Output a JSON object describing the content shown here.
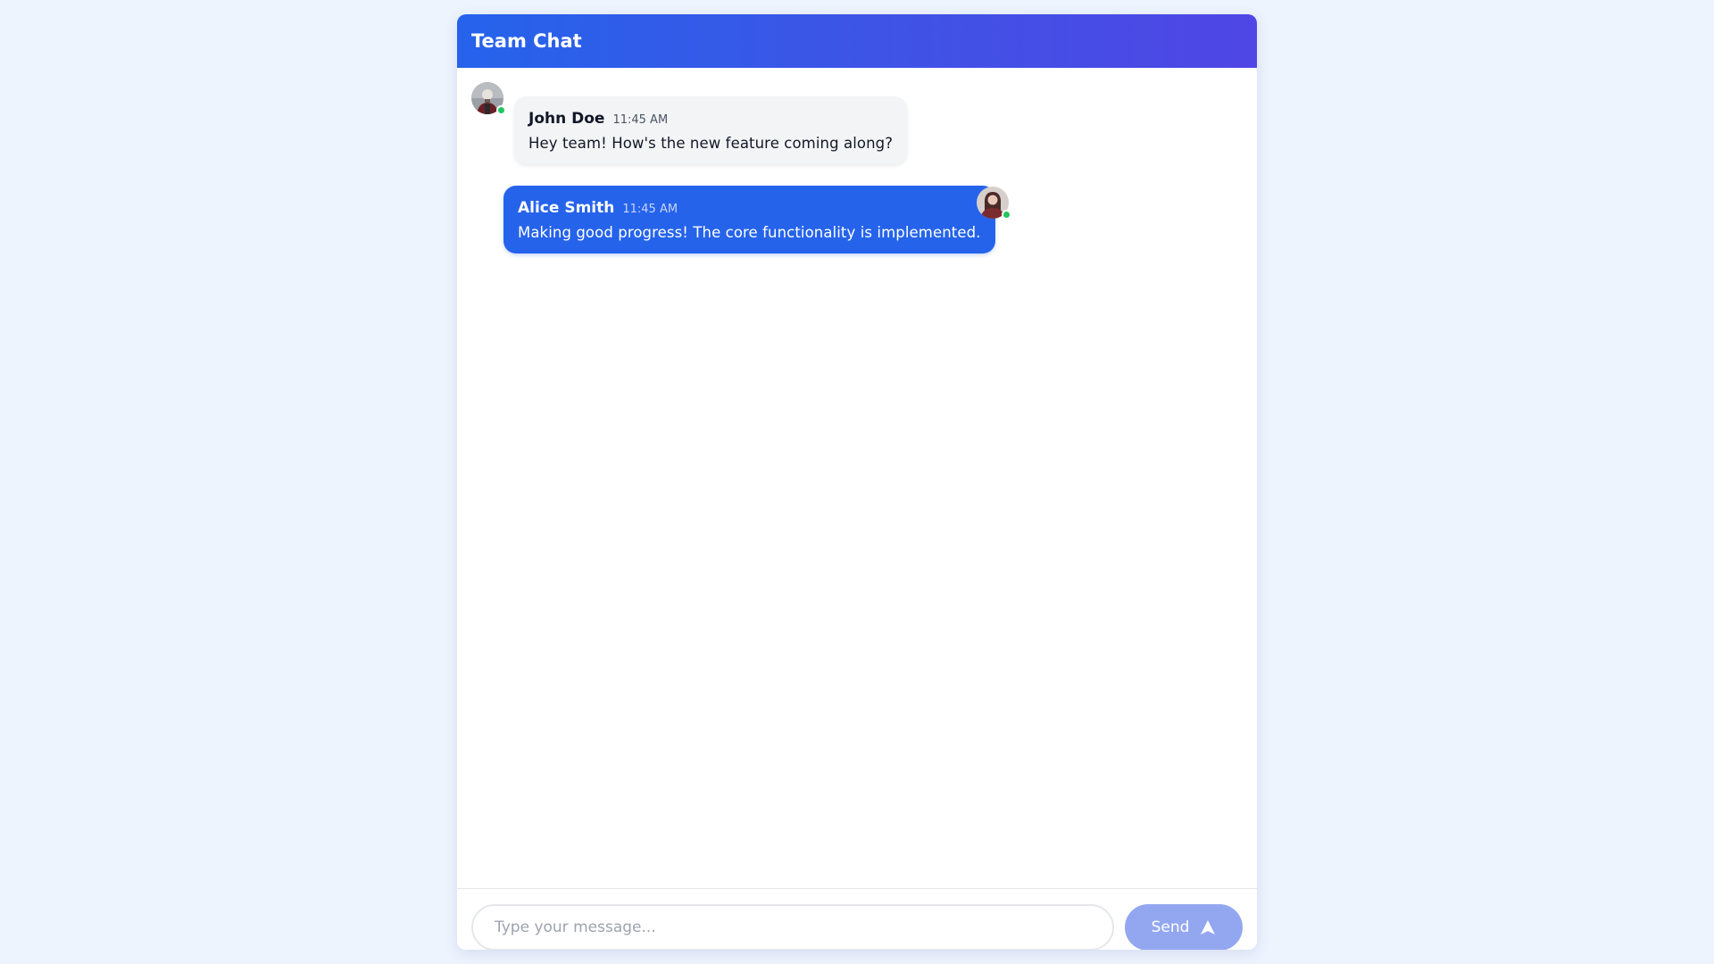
{
  "header": {
    "title": "Team Chat"
  },
  "messages": [
    {
      "sender": "John Doe",
      "time": "11:45 AM",
      "text": "Hey team! How's the new feature coming along?",
      "direction": "incoming",
      "avatar_icon": "user-avatar-icon",
      "online": true
    },
    {
      "sender": "Alice Smith",
      "time": "11:45 AM",
      "text": "Making good progress! The core functionality is implemented.",
      "direction": "outgoing",
      "avatar_icon": "user-avatar-icon",
      "online": true
    }
  ],
  "composer": {
    "placeholder": "Type your message...",
    "value": "",
    "send_label": "Send",
    "send_icon": "send-arrow-icon"
  },
  "colors": {
    "header_gradient_start": "#2563eb",
    "header_gradient_end": "#4f46e5",
    "outgoing_bubble": "#2563eb",
    "incoming_bubble": "#f3f4f6",
    "online_status": "#22c55e",
    "send_button": "#93a7f0",
    "page_background": "#eef4fe"
  }
}
